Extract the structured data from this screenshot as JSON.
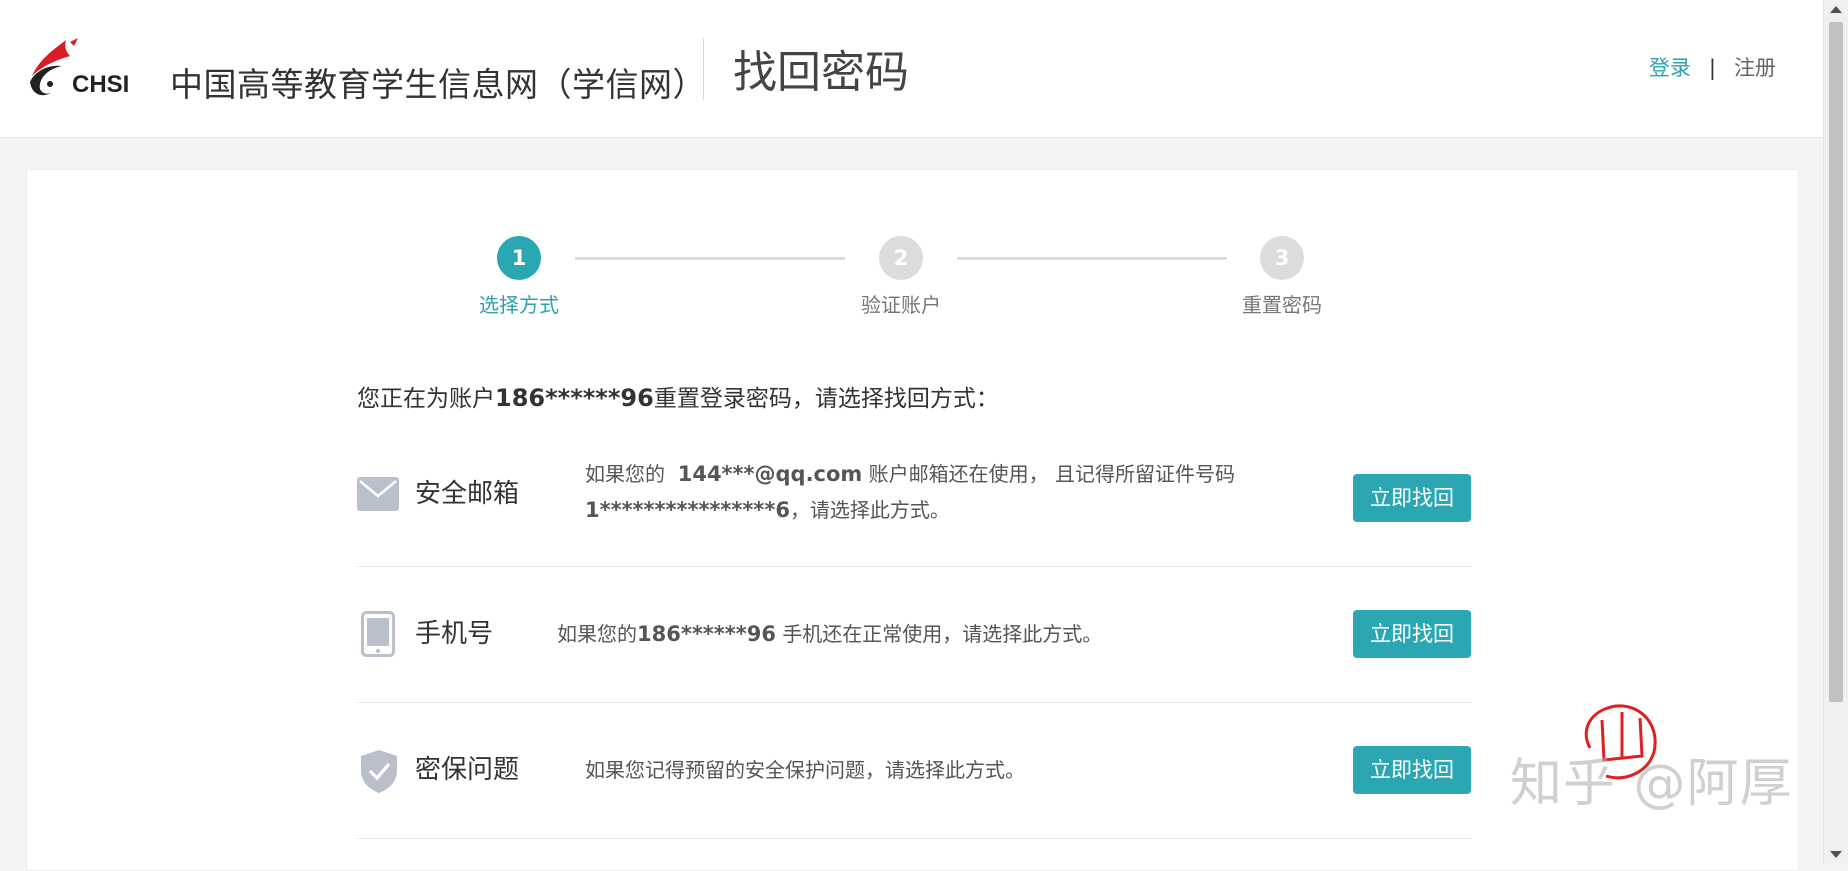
{
  "header": {
    "logo_text": "CHSI",
    "site_name": "中国高等教育学生信息网（学信网）",
    "page_title": "找回密码",
    "login_label": "登录",
    "separator": "|",
    "register_label": "注册"
  },
  "steps": [
    {
      "number": "1",
      "label": "选择方式",
      "active": true
    },
    {
      "number": "2",
      "label": "验证账户",
      "active": false
    },
    {
      "number": "3",
      "label": "重置密码",
      "active": false
    }
  ],
  "intro": {
    "prefix": "您正在为账户",
    "account": "186******96",
    "suffix": "重置登录密码，请选择找回方式："
  },
  "options": [
    {
      "title": "安全邮箱",
      "icon": "mail-icon",
      "desc_line1_prefix": "如果您的",
      "email": "144***@qq.com",
      "desc_line1_suffix": "账户邮箱还在使用， 且记得所留证件号码",
      "id_number": "1****************6",
      "desc_line2_suffix": "，请选择此方式。",
      "button": "立即找回"
    },
    {
      "title": "手机号",
      "icon": "phone-icon",
      "desc_prefix": "如果您的",
      "phone": "186******96",
      "desc_suffix": "手机还在正常使用，请选择此方式。",
      "button": "立即找回"
    },
    {
      "title": "密保问题",
      "icon": "shield-check-icon",
      "desc": "如果您记得预留的安全保护问题，请选择此方式。",
      "button": "立即找回"
    }
  ],
  "watermark": "知乎 @阿厚",
  "colors": {
    "accent": "#2aa7b3",
    "step_inactive": "#dcdcdc",
    "icon_gray": "#b9bfcb"
  }
}
